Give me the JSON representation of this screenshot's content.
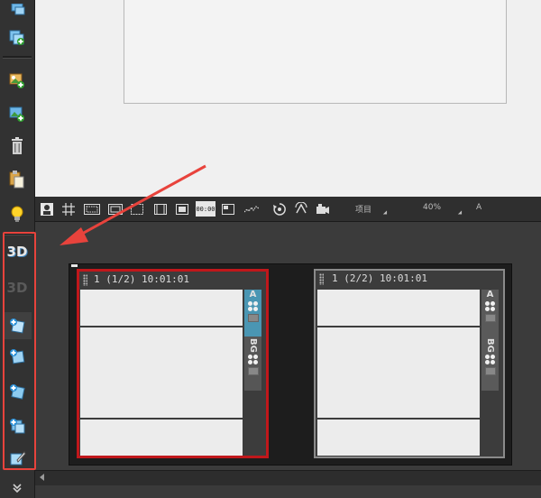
{
  "toolbar": {
    "timecode_icon_text": "00:00",
    "project_label": "项目",
    "zoom_label": "40%",
    "font_label": "A"
  },
  "left_bar": {
    "text_3d_label": "3D",
    "text_3d_disabled_label": "3D"
  },
  "storyboard": {
    "frames": [
      {
        "header": "1 (1/2) 10:01:01",
        "side_a": "A",
        "side_bg": "BG",
        "selected": true
      },
      {
        "header": "1 (2/2) 10:01:01",
        "side_a": "A",
        "side_bg": "BG",
        "selected": false
      }
    ]
  },
  "colors": {
    "selection_border": "#c0171b",
    "annotation": "#e8433c",
    "accent_tab": "#4a96b3"
  }
}
